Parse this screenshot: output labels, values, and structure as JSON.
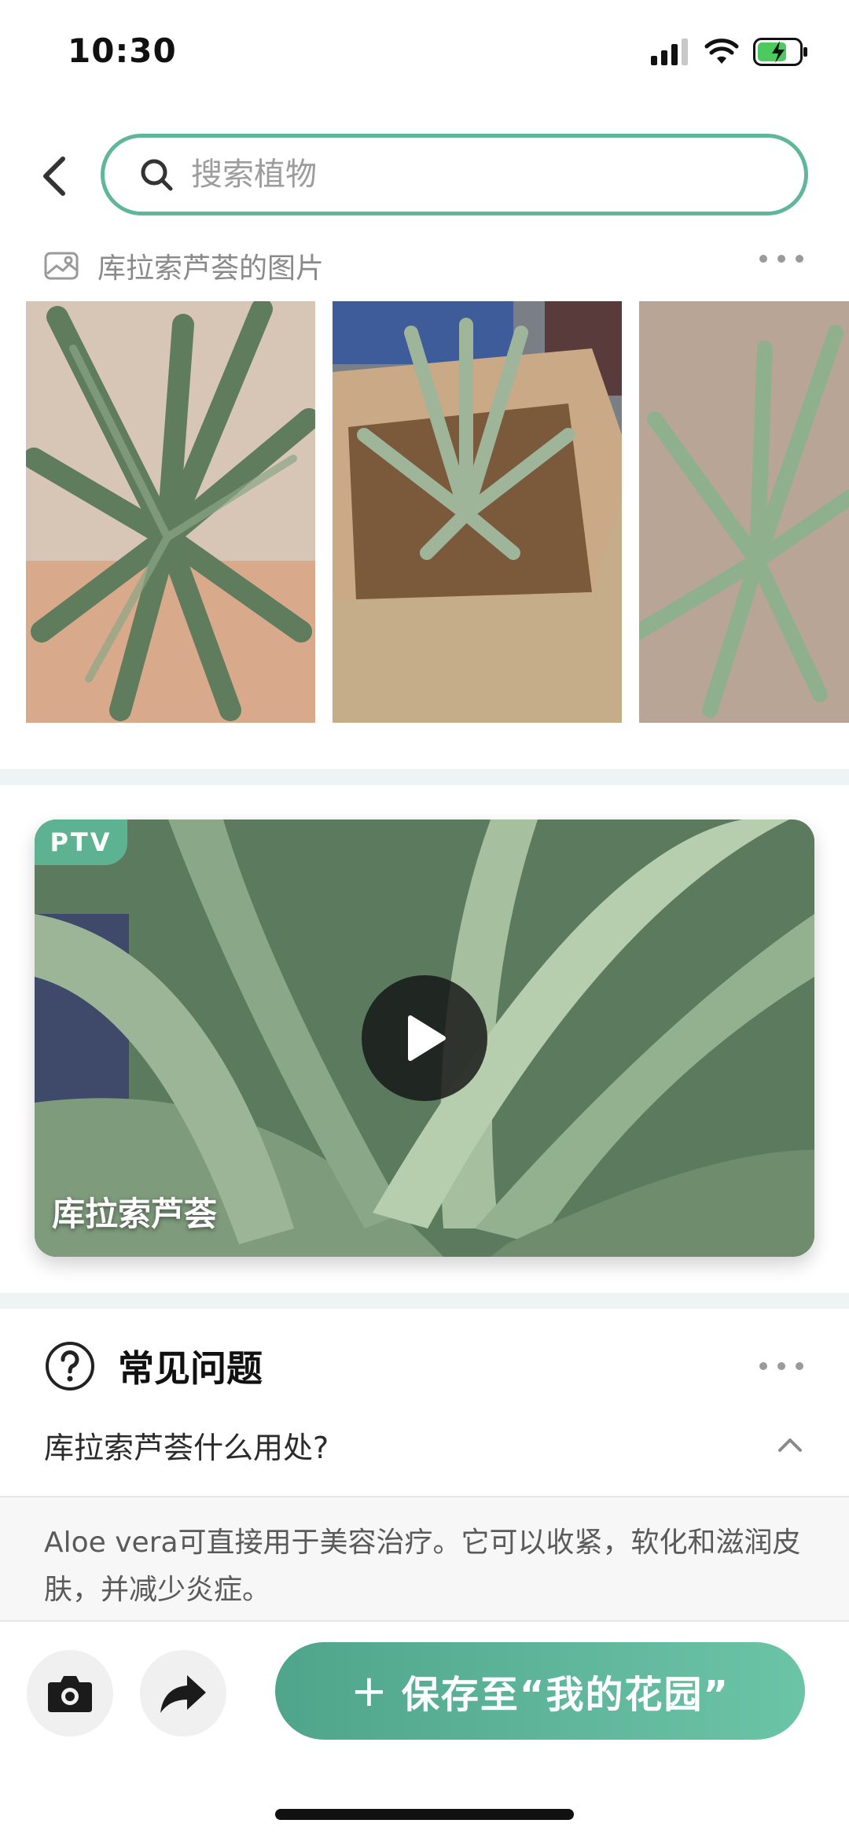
{
  "status_bar": {
    "time": "10:30"
  },
  "search": {
    "placeholder": "搜索植物"
  },
  "photos": {
    "title": "库拉索芦荟的图片"
  },
  "video": {
    "badge": "PTV",
    "title": "库拉索芦荟"
  },
  "faq": {
    "title": "常见问题",
    "question": "库拉索芦荟什么用处?",
    "answer": "Aloe vera可直接用于美容治疗。它可以收紧，软化和滋润皮肤，并减少炎症。"
  },
  "actions": {
    "save_label": "保存至“我的花园”"
  },
  "colors": {
    "accent": "#5fb79a",
    "button": "#5db391"
  }
}
